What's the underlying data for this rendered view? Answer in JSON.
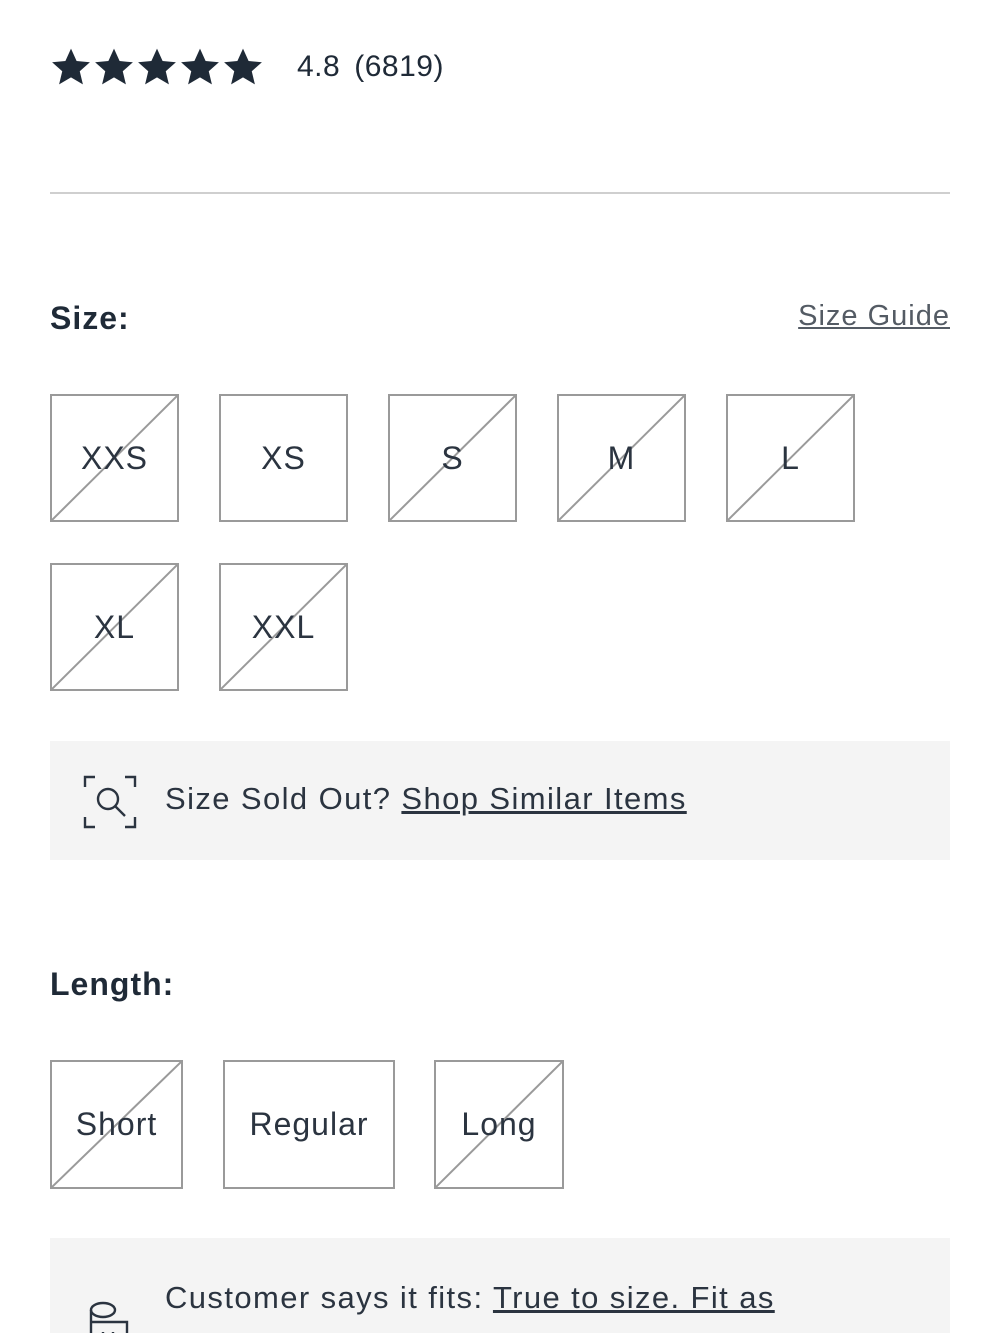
{
  "rating": {
    "stars": 5,
    "score": "4.8",
    "count": "(6819)",
    "star_color": "#1f2a37",
    "star_icon": "star-icon"
  },
  "size": {
    "label": "Size:",
    "guide_link": "Size Guide",
    "options": [
      {
        "label": "XXS",
        "available": false
      },
      {
        "label": "XS",
        "available": true
      },
      {
        "label": "S",
        "available": false
      },
      {
        "label": "M",
        "available": false
      },
      {
        "label": "L",
        "available": false
      },
      {
        "label": "XL",
        "available": false
      },
      {
        "label": "XXL",
        "available": false
      }
    ]
  },
  "sold_out": {
    "icon": "search-scan-icon",
    "text": "Size Sold Out? ",
    "link": "Shop Similar Items"
  },
  "length": {
    "label": "Length:",
    "options": [
      {
        "label": "Short",
        "available": false
      },
      {
        "label": "Regular",
        "available": true
      },
      {
        "label": "Long",
        "available": false
      }
    ]
  },
  "fit": {
    "icon": "fit-chart-icon",
    "text": "Customer says it fits: ",
    "link": "True to size. Fit as"
  },
  "colors": {
    "text_dark": "#1f2a37",
    "border": "#9a9a9a",
    "panel_bg": "#f4f4f4",
    "divider": "#cfcfcf"
  }
}
